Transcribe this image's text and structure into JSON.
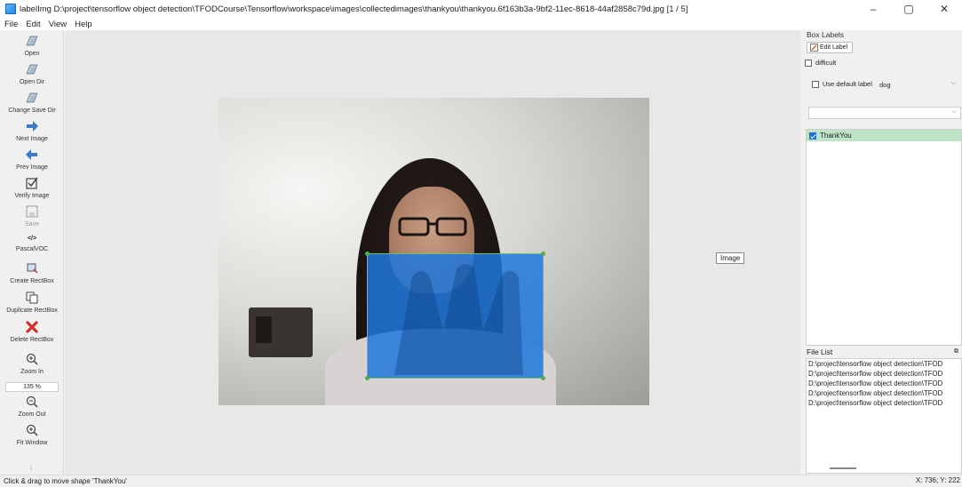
{
  "window": {
    "title": "labelImg D:\\project\\tensorflow object detection\\TFODCourse\\Tensorflow\\workspace\\images\\collectedimages\\thankyou\\thankyou.6f163b3a-9bf2-11ec-8618-44af2858c79d.jpg [1 / 5]",
    "minimize": "–",
    "maximize": "▢",
    "close": "✕"
  },
  "menu": [
    "File",
    "Edit",
    "View",
    "Help"
  ],
  "toolbar": {
    "open": "Open",
    "open_dir": "Open Dir",
    "change_save_dir": "Change Save Dir",
    "next_image": "Next Image",
    "prev_image": "Prev Image",
    "verify_image": "Verify Image",
    "save": "Save",
    "format_icon": "</>",
    "format": "PascalVOC",
    "create_rectbox": "Create RectBox",
    "duplicate_rectbox": "Duplicate RectBox",
    "delete_rectbox": "Delete RectBox",
    "zoom_in": "Zoom In",
    "zoom_value": "135 %",
    "zoom_out": "Zoom Out",
    "fit_window": "Fit Window"
  },
  "canvas": {
    "tooltip": "Image",
    "shape_label": "ThankYou"
  },
  "box_labels": {
    "title": "Box Labels",
    "edit_label": "Edit Label",
    "difficult": "difficult",
    "use_default_label": "Use default label",
    "default_label_value": "dog",
    "labels": [
      {
        "name": "ThankYou",
        "checked": true
      }
    ]
  },
  "file_list": {
    "title": "File List",
    "files": [
      "D:\\project\\tensorflow object detection\\TFOD",
      "D:\\project\\tensorflow object detection\\TFOD",
      "D:\\project\\tensorflow object detection\\TFOD",
      "D:\\project\\tensorflow object detection\\TFOD",
      "D:\\project\\tensorflow object detection\\TFOD"
    ]
  },
  "status": {
    "message": "Click & drag to move shape 'ThankYou'",
    "coords": "X: 736; Y: 222"
  },
  "colors": {
    "bbox_fill": "#1e78dc",
    "vertex": "#4caf50",
    "label_selected": "#bfe4c8"
  }
}
